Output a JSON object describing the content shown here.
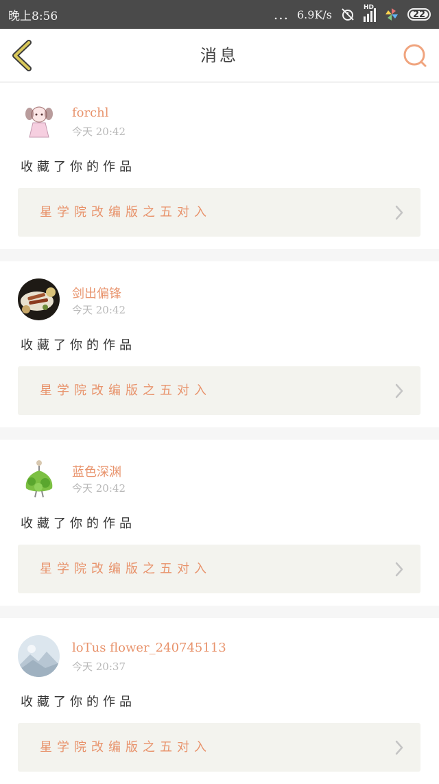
{
  "status_bar": {
    "time": "晚上8:56",
    "dots": "...",
    "speed": "6.9K/s",
    "network": "HD",
    "battery": "22"
  },
  "nav": {
    "title": "消息",
    "back_icon": "chevron-left-icon",
    "search_icon": "search-icon"
  },
  "colors": {
    "accent": "#e8936c",
    "back_icon": "#c9b44a",
    "link_bg": "#f3f3ee"
  },
  "messages": [
    {
      "username": "forchl",
      "time": "今天 20:42",
      "action": "收藏了你的作品",
      "work_title": "星学院改编版之五对入",
      "avatar": "girl-drawing-avatar"
    },
    {
      "username": "剑出偏锋",
      "time": "今天 20:42",
      "action": "收藏了你的作品",
      "work_title": "星学院改编版之五对入",
      "avatar": "food-photo-avatar"
    },
    {
      "username": "蓝色深渊",
      "time": "今天 20:42",
      "action": "收藏了你的作品",
      "work_title": "星学院改编版之五对入",
      "avatar": "green-dress-avatar"
    },
    {
      "username": "loTus flower_240745113",
      "time": "今天 20:37",
      "action": "收藏了你的作品",
      "work_title": "星学院改编版之五对入",
      "avatar": "default-mountain-avatar"
    }
  ]
}
